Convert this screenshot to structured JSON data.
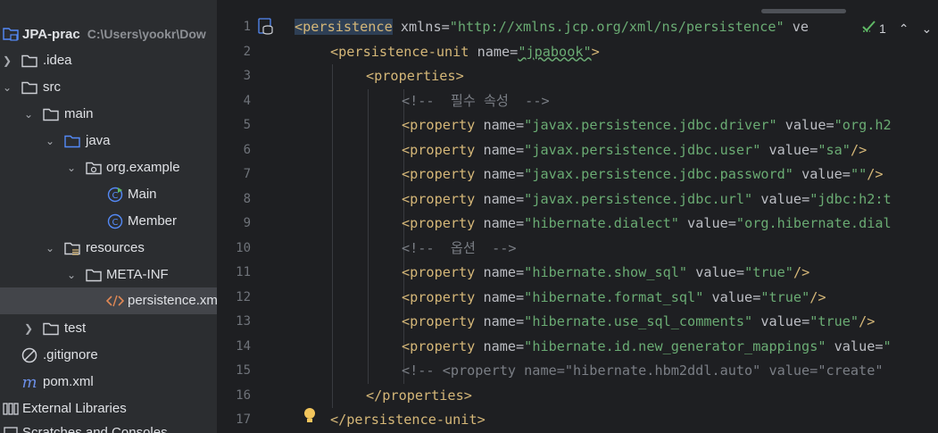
{
  "project": {
    "name": "JPA-prac",
    "path": "C:\\Users\\yookr\\Dow"
  },
  "tree": [
    {
      "label": ".idea",
      "icon": "folder-icon",
      "expanded": false
    },
    {
      "label": "src",
      "icon": "folder-icon",
      "expanded": true
    },
    {
      "label": "main",
      "icon": "folder-icon",
      "expanded": true
    },
    {
      "label": "java",
      "icon": "source-folder-icon",
      "expanded": true
    },
    {
      "label": "org.example",
      "icon": "package-icon",
      "expanded": true
    },
    {
      "label": "Main",
      "icon": "class-run-icon"
    },
    {
      "label": "Member",
      "icon": "class-icon"
    },
    {
      "label": "resources",
      "icon": "resources-folder-icon",
      "expanded": true
    },
    {
      "label": "META-INF",
      "icon": "folder-icon",
      "expanded": true
    },
    {
      "label": "persistence.xml",
      "icon": "xml-icon",
      "selected": true
    },
    {
      "label": "test",
      "icon": "folder-icon",
      "expanded": false
    },
    {
      "label": ".gitignore",
      "icon": "gitignore-icon"
    },
    {
      "label": "pom.xml",
      "icon": "maven-icon"
    },
    {
      "label": "External Libraries",
      "icon": "libraries-icon"
    },
    {
      "label": "Scratches and Consoles",
      "icon": "scratches-icon"
    }
  ],
  "inspection": {
    "count": "1"
  },
  "line_numbers": [
    "1",
    "2",
    "3",
    "4",
    "5",
    "6",
    "7",
    "8",
    "9",
    "10",
    "11",
    "12",
    "13",
    "14",
    "15",
    "16",
    "17"
  ],
  "code": {
    "l1": {
      "tag_open": "<persistence",
      "attr": " xmlns=",
      "val": "\"http://xmlns.jcp.org/xml/ns/persistence\"",
      "rest": " ve"
    },
    "l2": {
      "tag_open": "<persistence-unit",
      "attr": " name=",
      "val": "\"jpabook\"",
      "tag_close": ">"
    },
    "l3": {
      "tag": "<properties>"
    },
    "l4": {
      "comment": "<!--  필수 속성  -->"
    },
    "l5": {
      "tag_open": "<property",
      "attr1": " name=",
      "val1": "\"javax.persistence.jdbc.driver\"",
      "attr2": " value=",
      "val2": "\"org.h2"
    },
    "l6": {
      "tag_open": "<property",
      "attr1": " name=",
      "val1": "\"javax.persistence.jdbc.user\"",
      "attr2": " value=",
      "val2": "\"sa\"",
      "tag_close": "/>"
    },
    "l7": {
      "tag_open": "<property",
      "attr1": " name=",
      "val1": "\"javax.persistence.jdbc.password\"",
      "attr2": " value=",
      "val2": "\"\"",
      "tag_close": "/>"
    },
    "l8": {
      "tag_open": "<property",
      "attr1": " name=",
      "val1": "\"javax.persistence.jdbc.url\"",
      "attr2": " value=",
      "val2": "\"jdbc:h2:t"
    },
    "l9": {
      "tag_open": "<property",
      "attr1": " name=",
      "val1": "\"hibernate.dialect\"",
      "attr2": " value=",
      "val2": "\"org.hibernate.dial"
    },
    "l10": {
      "comment": "<!--  옵션  -->"
    },
    "l11": {
      "tag_open": "<property",
      "attr1": " name=",
      "val1": "\"hibernate.show_sql\"",
      "attr2": " value=",
      "val2": "\"true\"",
      "tag_close": "/>"
    },
    "l12": {
      "tag_open": "<property",
      "attr1": " name=",
      "val1": "\"hibernate.format_sql\"",
      "attr2": " value=",
      "val2": "\"true\"",
      "tag_close": "/>"
    },
    "l13": {
      "tag_open": "<property",
      "attr1": " name=",
      "val1": "\"hibernate.use_sql_comments\"",
      "attr2": " value=",
      "val2": "\"true\"",
      "tag_close": "/>"
    },
    "l14": {
      "tag_open": "<property",
      "attr1": " name=",
      "val1": "\"hibernate.id.new_generator_mappings\"",
      "attr2": " value=",
      "val2": "\""
    },
    "l15": {
      "comment": "<!-- <property name=\"hibernate.hbm2ddl.auto\" value=\"create\""
    },
    "l16": {
      "tag": "</properties>"
    },
    "l17": {
      "tag": "</persistence-unit>"
    }
  },
  "colors": {
    "tag": "#d5b778",
    "attribute": "#bcbec4",
    "value": "#6aab73",
    "comment": "#7a7e85",
    "sidebar_bg": "#2b2d30",
    "editor_bg": "#1e1f22",
    "selection": "#43454a"
  }
}
